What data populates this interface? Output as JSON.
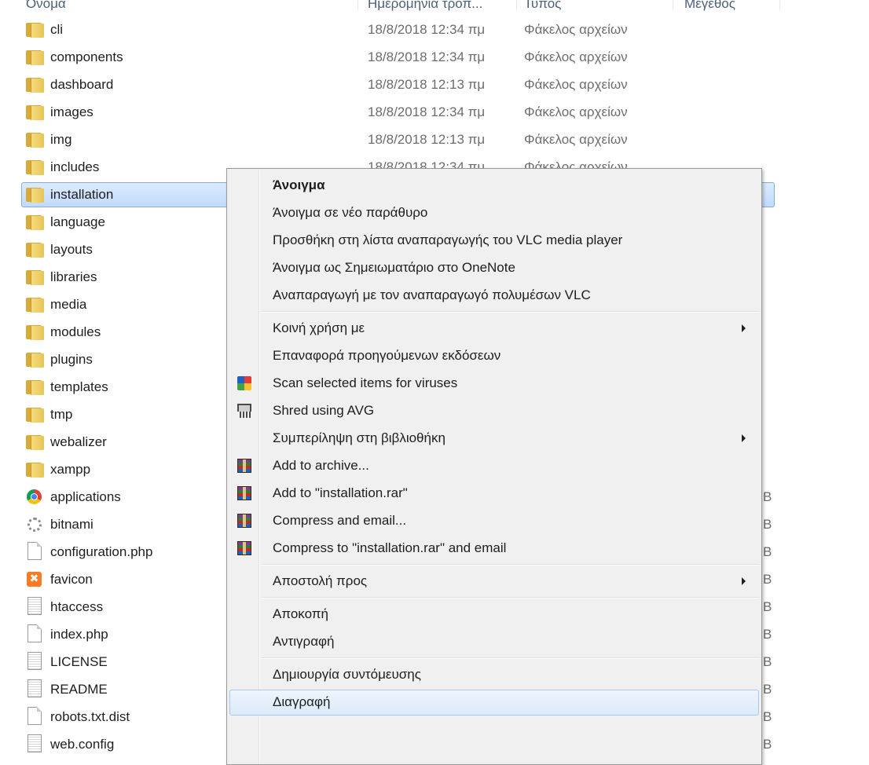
{
  "header": {
    "name": "Όνομα",
    "date_modified": "Ημερομηνία τροπ...",
    "type": "Τύπος",
    "size": "Μέγεθος"
  },
  "files": [
    {
      "name": "cli",
      "date": "18/8/2018 12:34 πμ",
      "type": "Φάκελος αρχείων",
      "size": "",
      "icon": "folder-icon"
    },
    {
      "name": "components",
      "date": "18/8/2018 12:34 πμ",
      "type": "Φάκελος αρχείων",
      "size": "",
      "icon": "folder-icon"
    },
    {
      "name": "dashboard",
      "date": "18/8/2018 12:13 πμ",
      "type": "Φάκελος αρχείων",
      "size": "",
      "icon": "folder-icon"
    },
    {
      "name": "images",
      "date": "18/8/2018 12:34 πμ",
      "type": "Φάκελος αρχείων",
      "size": "",
      "icon": "folder-icon"
    },
    {
      "name": "img",
      "date": "18/8/2018 12:13 πμ",
      "type": "Φάκελος αρχείων",
      "size": "",
      "icon": "folder-icon"
    },
    {
      "name": "includes",
      "date": "18/8/2018 12:34 πμ",
      "type": "Φάκελος αρχείων",
      "size": "",
      "icon": "folder-icon"
    },
    {
      "name": "installation",
      "date": "",
      "type": "",
      "size": "",
      "icon": "folder-icon",
      "selected": true
    },
    {
      "name": "language",
      "date": "",
      "type": "",
      "size": "",
      "icon": "folder-icon"
    },
    {
      "name": "layouts",
      "date": "",
      "type": "",
      "size": "",
      "icon": "folder-icon"
    },
    {
      "name": "libraries",
      "date": "",
      "type": "",
      "size": "",
      "icon": "folder-icon"
    },
    {
      "name": "media",
      "date": "",
      "type": "",
      "size": "",
      "icon": "folder-icon"
    },
    {
      "name": "modules",
      "date": "",
      "type": "",
      "size": "",
      "icon": "folder-icon"
    },
    {
      "name": "plugins",
      "date": "",
      "type": "",
      "size": "",
      "icon": "folder-icon"
    },
    {
      "name": "templates",
      "date": "",
      "type": "",
      "size": "",
      "icon": "folder-icon"
    },
    {
      "name": "tmp",
      "date": "",
      "type": "",
      "size": "",
      "icon": "folder-icon"
    },
    {
      "name": "webalizer",
      "date": "",
      "type": "",
      "size": "",
      "icon": "folder-icon"
    },
    {
      "name": "xampp",
      "date": "",
      "type": "",
      "size": "",
      "icon": "folder-icon"
    },
    {
      "name": "applications",
      "date": "",
      "type": "",
      "size": "B",
      "icon": "chrome-icon"
    },
    {
      "name": "bitnami",
      "date": "",
      "type": "",
      "size": "B",
      "icon": "gear-icon"
    },
    {
      "name": "configuration.php",
      "date": "",
      "type": "",
      "size": "B",
      "icon": "doc-icon"
    },
    {
      "name": "favicon",
      "date": "",
      "type": "",
      "size": "B",
      "icon": "xampp-icon"
    },
    {
      "name": "htaccess",
      "date": "",
      "type": "",
      "size": "B",
      "icon": "doc-lines-icon"
    },
    {
      "name": "index.php",
      "date": "",
      "type": "",
      "size": "B",
      "icon": "doc-icon"
    },
    {
      "name": "LICENSE",
      "date": "",
      "type": "",
      "size": "B",
      "icon": "doc-lines-icon"
    },
    {
      "name": "README",
      "date": "",
      "type": "",
      "size": "B",
      "icon": "doc-lines-icon"
    },
    {
      "name": "robots.txt.dist",
      "date": "",
      "type": "",
      "size": "B",
      "icon": "doc-icon"
    },
    {
      "name": "web.config",
      "date": "",
      "type": "",
      "size": "B",
      "icon": "doc-lines-icon"
    }
  ],
  "context_menu": [
    {
      "label": "Άνοιγμα",
      "bold": true
    },
    {
      "label": "Άνοιγμα σε νέο παράθυρο"
    },
    {
      "label": "Προσθήκη στη λίστα αναπαραγωγής του VLC media player"
    },
    {
      "label": "Άνοιγμα ως Σημειωματάριο στο OneNote"
    },
    {
      "label": "Αναπαραγωγή με τον αναπαραγωγό πολυμέσων VLC"
    },
    {
      "separator": true
    },
    {
      "label": "Κοινή χρήση με",
      "submenu": true
    },
    {
      "label": "Επαναφορά προηγούμενων εκδόσεων"
    },
    {
      "label": "Scan selected items for viruses",
      "icon": "avg-icon"
    },
    {
      "label": "Shred using AVG",
      "icon": "shred-icon"
    },
    {
      "label": "Συμπερίληψη στη βιβλιοθήκη",
      "submenu": true
    },
    {
      "label": "Add to archive...",
      "icon": "winrar-icon"
    },
    {
      "label": "Add to \"installation.rar\"",
      "icon": "winrar-icon"
    },
    {
      "label": "Compress and email...",
      "icon": "winrar-icon"
    },
    {
      "label": "Compress to \"installation.rar\" and email",
      "icon": "winrar-icon"
    },
    {
      "separator": true
    },
    {
      "label": "Αποστολή προς",
      "submenu": true
    },
    {
      "separator": true
    },
    {
      "label": "Αποκοπή"
    },
    {
      "label": "Αντιγραφή"
    },
    {
      "separator": true
    },
    {
      "label": "Δημιουργία συντόμευσης"
    },
    {
      "label": "Διαγραφή",
      "hover": true
    }
  ],
  "colors": {
    "selection": "#cce8ff",
    "menu_bg": "#f0f0f0",
    "folder": "#e8c45a"
  }
}
